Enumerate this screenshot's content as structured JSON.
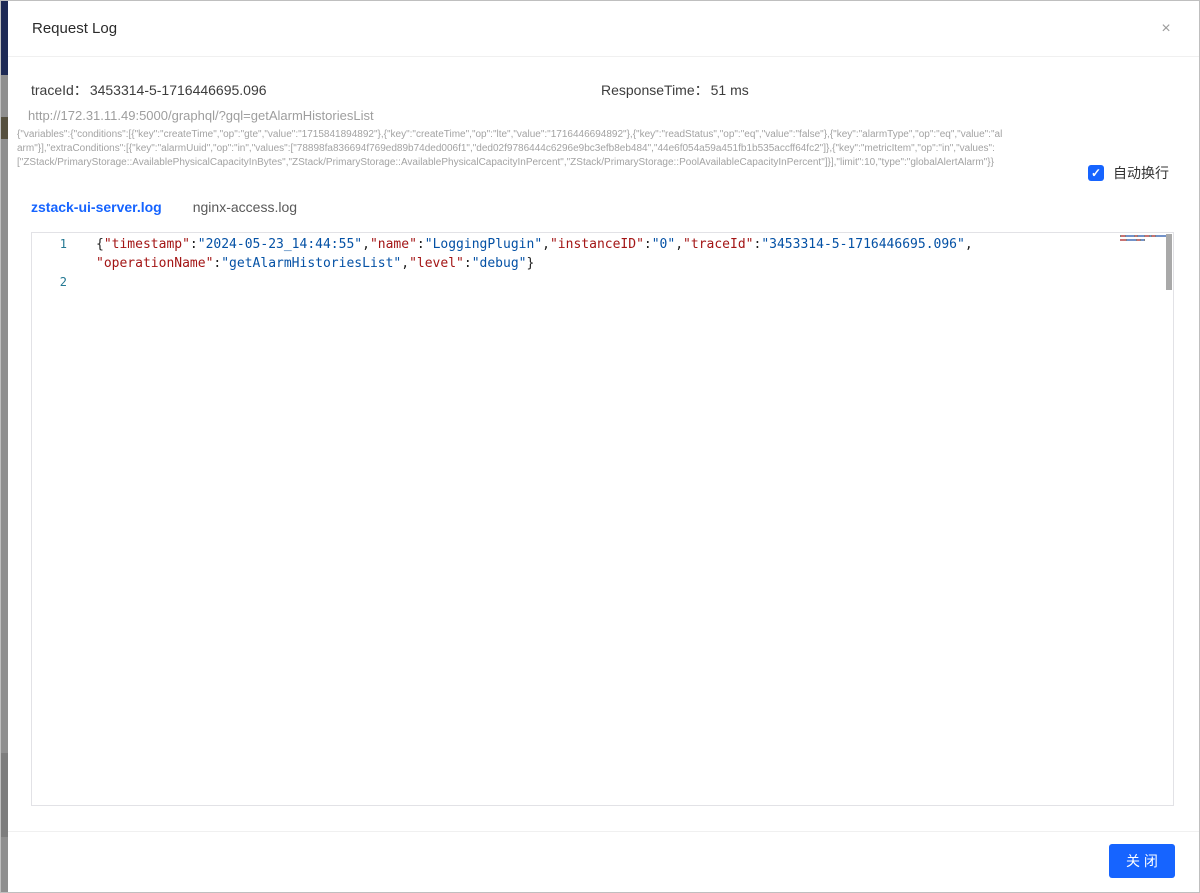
{
  "colors": {
    "accent": "#1664ff",
    "key_token": "#a31515",
    "value_token": "#0451a5",
    "punct_token": "#1e1e1e",
    "line_number": "#237893"
  },
  "window": {
    "title": "Request Log",
    "close_icon": "×"
  },
  "request_meta": {
    "trace_label": "traceId：",
    "trace_id": "3453314-5-1716446695.096",
    "response_time_label": "ResponseTime：",
    "response_time": "51 ms",
    "request_url": "http://172.31.11.49:5000/graphql/?gql=getAlarmHistoriesList",
    "request_payload": "{\"variables\":{\"conditions\":[{\"key\":\"createTime\",\"op\":\"gte\",\"value\":\"1715841894892\"},{\"key\":\"createTime\",\"op\":\"lte\",\"value\":\"1716446694892\"},{\"key\":\"readStatus\",\"op\":\"eq\",\"value\":\"false\"},{\"key\":\"alarmType\",\"op\":\"eq\",\"value\":\"alarm\"}],\"extraConditions\":[{\"key\":\"alarmUuid\",\"op\":\"in\",\"values\":[\"78898fa836694f769ed89b74ded006f1\",\"ded02f9786444c6296e9bc3efb8eb484\",\"44e6f054a59a451fb1b535accff64fc2\"]},{\"key\":\"metricItem\",\"op\":\"in\",\"values\":[\"ZStack/PrimaryStorage::AvailablePhysicalCapacityInBytes\",\"ZStack/PrimaryStorage::AvailablePhysicalCapacityInPercent\",\"ZStack/PrimaryStorage::PoolAvailableCapacityInPercent\"]}],\"limit\":10,\"type\":\"globalAlertAlarm\"}}"
  },
  "auto_wrap": {
    "label": "自动换行",
    "checked": true,
    "check_glyph": "✓"
  },
  "tabs": [
    {
      "label": "zstack-ui-server.log",
      "active": true
    },
    {
      "label": "nginx-access.log",
      "active": false
    }
  ],
  "editor": {
    "lines": [
      {
        "number": "1",
        "rows": [
          [
            [
              "p",
              "{"
            ],
            [
              "k",
              "\"timestamp\""
            ],
            [
              "p",
              ":"
            ],
            [
              "v",
              "\"2024-05-23_14:44:55\""
            ],
            [
              "p",
              ","
            ],
            [
              "k",
              "\"name\""
            ],
            [
              "p",
              ":"
            ],
            [
              "v",
              "\"LoggingPlugin\""
            ],
            [
              "p",
              ","
            ],
            [
              "k",
              "\"instanceID\""
            ],
            [
              "p",
              ":"
            ],
            [
              "v",
              "\"0\""
            ],
            [
              "p",
              ","
            ],
            [
              "k",
              "\"traceId\""
            ],
            [
              "p",
              ":"
            ],
            [
              "v",
              "\"3453314-5-1716446695.096\""
            ],
            [
              "p",
              ","
            ]
          ],
          [
            [
              "k",
              "\"operationName\""
            ],
            [
              "p",
              ":"
            ],
            [
              "v",
              "\"getAlarmHistoriesList\""
            ],
            [
              "p",
              ","
            ],
            [
              "k",
              "\"level\""
            ],
            [
              "p",
              ":"
            ],
            [
              "v",
              "\"debug\""
            ],
            [
              "p",
              "}"
            ]
          ]
        ]
      },
      {
        "number": "2",
        "rows": [
          []
        ]
      }
    ]
  },
  "footer": {
    "close_button": "关 闭"
  }
}
